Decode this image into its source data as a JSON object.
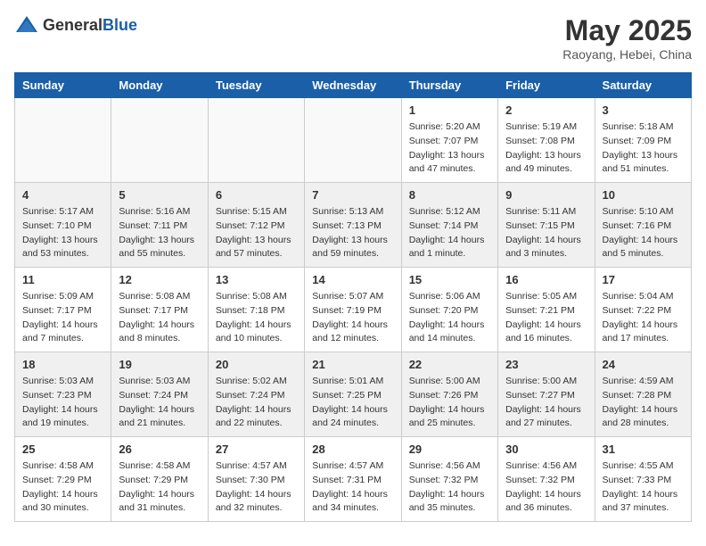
{
  "header": {
    "logo_general": "General",
    "logo_blue": "Blue",
    "month_year": "May 2025",
    "location": "Raoyang, Hebei, China"
  },
  "weekdays": [
    "Sunday",
    "Monday",
    "Tuesday",
    "Wednesday",
    "Thursday",
    "Friday",
    "Saturday"
  ],
  "weeks": [
    [
      {
        "day": "",
        "info": ""
      },
      {
        "day": "",
        "info": ""
      },
      {
        "day": "",
        "info": ""
      },
      {
        "day": "",
        "info": ""
      },
      {
        "day": "1",
        "info": "Sunrise: 5:20 AM\nSunset: 7:07 PM\nDaylight: 13 hours\nand 47 minutes."
      },
      {
        "day": "2",
        "info": "Sunrise: 5:19 AM\nSunset: 7:08 PM\nDaylight: 13 hours\nand 49 minutes."
      },
      {
        "day": "3",
        "info": "Sunrise: 5:18 AM\nSunset: 7:09 PM\nDaylight: 13 hours\nand 51 minutes."
      }
    ],
    [
      {
        "day": "4",
        "info": "Sunrise: 5:17 AM\nSunset: 7:10 PM\nDaylight: 13 hours\nand 53 minutes."
      },
      {
        "day": "5",
        "info": "Sunrise: 5:16 AM\nSunset: 7:11 PM\nDaylight: 13 hours\nand 55 minutes."
      },
      {
        "day": "6",
        "info": "Sunrise: 5:15 AM\nSunset: 7:12 PM\nDaylight: 13 hours\nand 57 minutes."
      },
      {
        "day": "7",
        "info": "Sunrise: 5:13 AM\nSunset: 7:13 PM\nDaylight: 13 hours\nand 59 minutes."
      },
      {
        "day": "8",
        "info": "Sunrise: 5:12 AM\nSunset: 7:14 PM\nDaylight: 14 hours\nand 1 minute."
      },
      {
        "day": "9",
        "info": "Sunrise: 5:11 AM\nSunset: 7:15 PM\nDaylight: 14 hours\nand 3 minutes."
      },
      {
        "day": "10",
        "info": "Sunrise: 5:10 AM\nSunset: 7:16 PM\nDaylight: 14 hours\nand 5 minutes."
      }
    ],
    [
      {
        "day": "11",
        "info": "Sunrise: 5:09 AM\nSunset: 7:17 PM\nDaylight: 14 hours\nand 7 minutes."
      },
      {
        "day": "12",
        "info": "Sunrise: 5:08 AM\nSunset: 7:17 PM\nDaylight: 14 hours\nand 8 minutes."
      },
      {
        "day": "13",
        "info": "Sunrise: 5:08 AM\nSunset: 7:18 PM\nDaylight: 14 hours\nand 10 minutes."
      },
      {
        "day": "14",
        "info": "Sunrise: 5:07 AM\nSunset: 7:19 PM\nDaylight: 14 hours\nand 12 minutes."
      },
      {
        "day": "15",
        "info": "Sunrise: 5:06 AM\nSunset: 7:20 PM\nDaylight: 14 hours\nand 14 minutes."
      },
      {
        "day": "16",
        "info": "Sunrise: 5:05 AM\nSunset: 7:21 PM\nDaylight: 14 hours\nand 16 minutes."
      },
      {
        "day": "17",
        "info": "Sunrise: 5:04 AM\nSunset: 7:22 PM\nDaylight: 14 hours\nand 17 minutes."
      }
    ],
    [
      {
        "day": "18",
        "info": "Sunrise: 5:03 AM\nSunset: 7:23 PM\nDaylight: 14 hours\nand 19 minutes."
      },
      {
        "day": "19",
        "info": "Sunrise: 5:03 AM\nSunset: 7:24 PM\nDaylight: 14 hours\nand 21 minutes."
      },
      {
        "day": "20",
        "info": "Sunrise: 5:02 AM\nSunset: 7:24 PM\nDaylight: 14 hours\nand 22 minutes."
      },
      {
        "day": "21",
        "info": "Sunrise: 5:01 AM\nSunset: 7:25 PM\nDaylight: 14 hours\nand 24 minutes."
      },
      {
        "day": "22",
        "info": "Sunrise: 5:00 AM\nSunset: 7:26 PM\nDaylight: 14 hours\nand 25 minutes."
      },
      {
        "day": "23",
        "info": "Sunrise: 5:00 AM\nSunset: 7:27 PM\nDaylight: 14 hours\nand 27 minutes."
      },
      {
        "day": "24",
        "info": "Sunrise: 4:59 AM\nSunset: 7:28 PM\nDaylight: 14 hours\nand 28 minutes."
      }
    ],
    [
      {
        "day": "25",
        "info": "Sunrise: 4:58 AM\nSunset: 7:29 PM\nDaylight: 14 hours\nand 30 minutes."
      },
      {
        "day": "26",
        "info": "Sunrise: 4:58 AM\nSunset: 7:29 PM\nDaylight: 14 hours\nand 31 minutes."
      },
      {
        "day": "27",
        "info": "Sunrise: 4:57 AM\nSunset: 7:30 PM\nDaylight: 14 hours\nand 32 minutes."
      },
      {
        "day": "28",
        "info": "Sunrise: 4:57 AM\nSunset: 7:31 PM\nDaylight: 14 hours\nand 34 minutes."
      },
      {
        "day": "29",
        "info": "Sunrise: 4:56 AM\nSunset: 7:32 PM\nDaylight: 14 hours\nand 35 minutes."
      },
      {
        "day": "30",
        "info": "Sunrise: 4:56 AM\nSunset: 7:32 PM\nDaylight: 14 hours\nand 36 minutes."
      },
      {
        "day": "31",
        "info": "Sunrise: 4:55 AM\nSunset: 7:33 PM\nDaylight: 14 hours\nand 37 minutes."
      }
    ]
  ]
}
